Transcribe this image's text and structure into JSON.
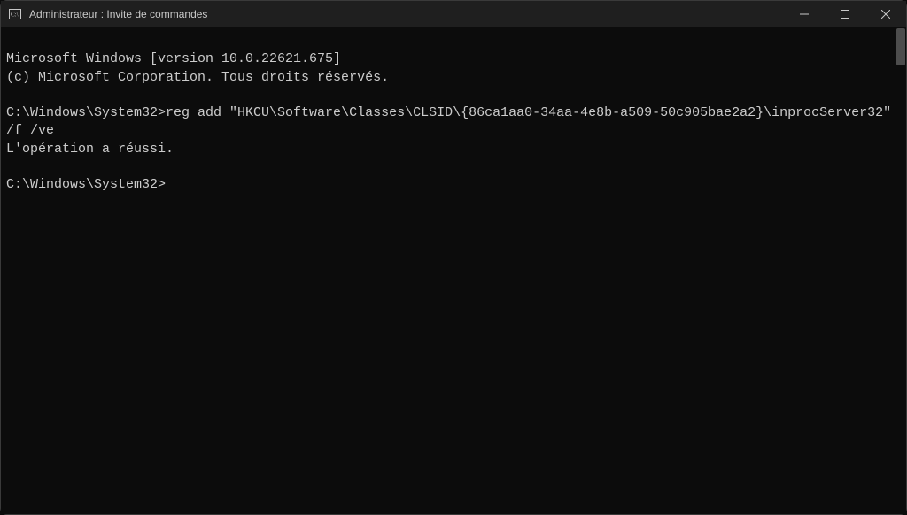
{
  "window": {
    "title": "Administrateur : Invite de commandes"
  },
  "terminal": {
    "line1": "Microsoft Windows [version 10.0.22621.675]",
    "line2": "(c) Microsoft Corporation. Tous droits réservés.",
    "blank1": "",
    "prompt1": "C:\\Windows\\System32>",
    "command1": "reg add \"HKCU\\Software\\Classes\\CLSID\\{86ca1aa0-34aa-4e8b-a509-50c905bae2a2}\\inprocServer32\" /f /ve",
    "result1": "L'opération a réussi.",
    "blank2": "",
    "prompt2": "C:\\Windows\\System32>"
  }
}
